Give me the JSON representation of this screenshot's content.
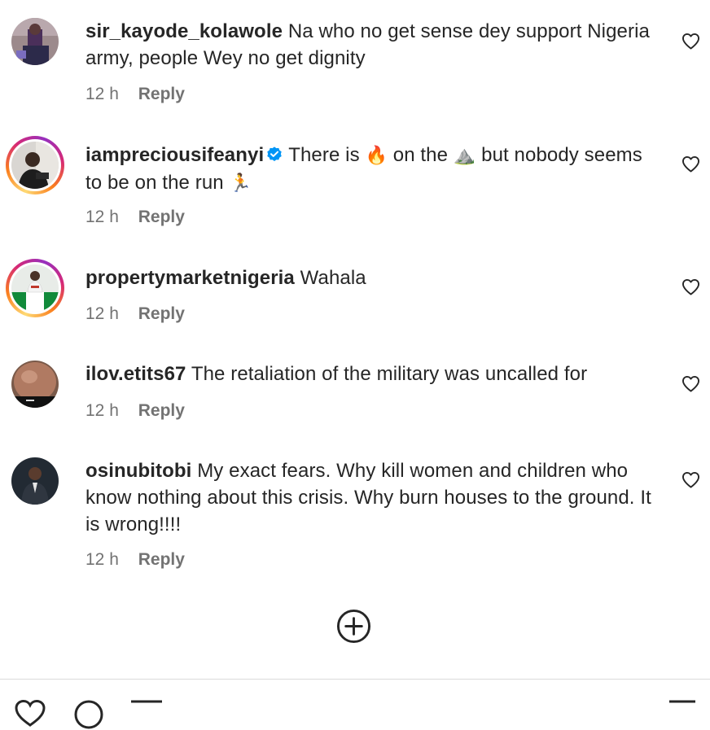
{
  "comments": [
    {
      "username": "sir_kayode_kolawole",
      "text": "Na who no get sense dey support Nigeria army, people Wey no get dignity",
      "time": "12 h",
      "reply": "Reply",
      "verified": false,
      "story_ring": false
    },
    {
      "username": "iampreciousifeanyi",
      "text_parts": [
        "There is ",
        "🔥",
        " on the ",
        "⛰️",
        " but nobody seems to be on the run ",
        "🏃"
      ],
      "time": "12 h",
      "reply": "Reply",
      "verified": true,
      "story_ring": true
    },
    {
      "username": "propertymarketnigeria",
      "text": "Wahala",
      "time": "12 h",
      "reply": "Reply",
      "verified": false,
      "story_ring": true
    },
    {
      "username": "ilov.etits67",
      "text": "The retaliation of the military was uncalled for",
      "time": "12 h",
      "reply": "Reply",
      "verified": false,
      "story_ring": false
    },
    {
      "username": "osinubitobi",
      "text": "My exact fears. Why kill women and children who know nothing about this crisis. Why burn houses to the ground. It is wrong!!!!",
      "time": "12 h",
      "reply": "Reply",
      "verified": false,
      "story_ring": false
    }
  ],
  "icons": {
    "like": "heart-outline-icon",
    "load_more": "plus-circle-icon",
    "verified": "verified-badge-icon",
    "bottom_bar": [
      "heart-icon",
      "comment-icon",
      "share-icon",
      "bookmark-icon"
    ]
  },
  "colors": {
    "text": "#262626",
    "secondary": "#737373",
    "verified": "#0095f6",
    "divider": "#dbdbdb"
  }
}
